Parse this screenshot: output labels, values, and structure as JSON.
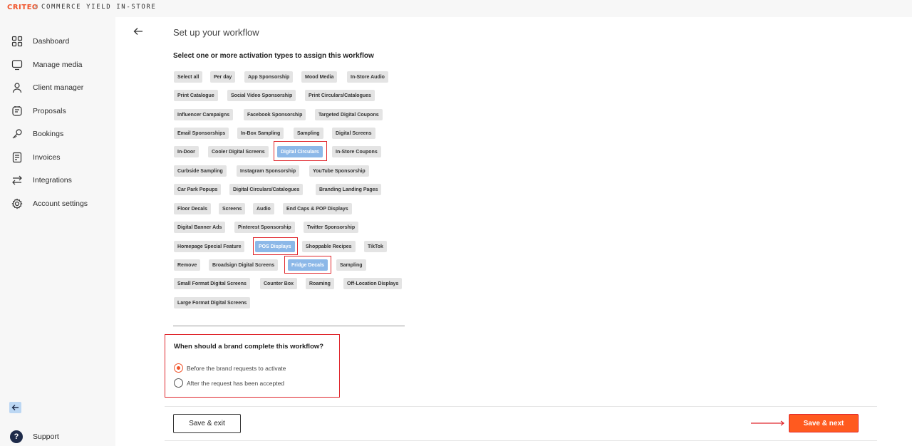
{
  "header": {
    "brand": "CRITEO",
    "separator": "//",
    "product": "COMMERCE YIELD IN-STORE"
  },
  "sidebar": {
    "items": [
      {
        "label": "Dashboard",
        "icon": "dashboard-icon"
      },
      {
        "label": "Manage media",
        "icon": "monitor-icon"
      },
      {
        "label": "Client manager",
        "icon": "user-icon"
      },
      {
        "label": "Proposals",
        "icon": "proposal-icon"
      },
      {
        "label": "Bookings",
        "icon": "key-icon"
      },
      {
        "label": "Invoices",
        "icon": "invoice-icon"
      },
      {
        "label": "Integrations",
        "icon": "arrows-icon"
      },
      {
        "label": "Account settings",
        "icon": "gear-icon"
      }
    ],
    "collapse_icon": "arrow-left-icon",
    "support_label": "Support",
    "support_icon_glyph": "?"
  },
  "page": {
    "title": "Set up your workflow",
    "section_title": "Select one or more activation types to assign this workflow",
    "chips": [
      {
        "label": "Select all",
        "selected": false
      },
      {
        "label": "Per day",
        "selected": false
      },
      {
        "label": "App Sponsorship",
        "selected": false
      },
      {
        "label": "Mood Media",
        "selected": false
      },
      {
        "label": "In-Store Audio",
        "selected": false
      },
      {
        "label": "Print Catalogue",
        "selected": false
      },
      {
        "label": "Social Video Sponsorship",
        "selected": false
      },
      {
        "label": "Print Circulars/Catalogues",
        "selected": false
      },
      {
        "label": "Influencer Campaigns",
        "selected": false
      },
      {
        "label": "Facebook Sponsorship",
        "selected": false
      },
      {
        "label": "Targeted Digital Coupons",
        "selected": false
      },
      {
        "label": "Email Sponsorships",
        "selected": false
      },
      {
        "label": "In-Box Sampling",
        "selected": false
      },
      {
        "label": "Sampling",
        "selected": false
      },
      {
        "label": "Digital Screens",
        "selected": false
      },
      {
        "label": "In-Door",
        "selected": false
      },
      {
        "label": "Cooler Digital Screens",
        "selected": false
      },
      {
        "label": "Digital Circulars",
        "selected": true
      },
      {
        "label": "In-Store Coupons",
        "selected": false
      },
      {
        "label": "Curbside Sampling",
        "selected": false
      },
      {
        "label": "Instagram Sponsorship",
        "selected": false
      },
      {
        "label": "YouTube Sponsorship",
        "selected": false
      },
      {
        "label": "Car Park Popups",
        "selected": false
      },
      {
        "label": "Digital Circulars/Catalogues",
        "selected": false
      },
      {
        "label": "Branding Landing Pages",
        "selected": false
      },
      {
        "label": "Floor Decals",
        "selected": false
      },
      {
        "label": "Screens",
        "selected": false
      },
      {
        "label": "Audio",
        "selected": false
      },
      {
        "label": "End Caps & POP Displays",
        "selected": false
      },
      {
        "label": "Digital Banner Ads",
        "selected": false
      },
      {
        "label": "Pinterest Sponsorship",
        "selected": false
      },
      {
        "label": "Twitter Sponsorship",
        "selected": false
      },
      {
        "label": "Homepage Special Feature",
        "selected": false
      },
      {
        "label": "POS Displays",
        "selected": true
      },
      {
        "label": "Shoppable Recipes",
        "selected": false
      },
      {
        "label": "TikTok",
        "selected": false
      },
      {
        "label": "Remove",
        "selected": false
      },
      {
        "label": "Broadsign Digital Screens",
        "selected": false
      },
      {
        "label": "Fridge Decals",
        "selected": true
      },
      {
        "label": "Sampling",
        "selected": false
      },
      {
        "label": "Small Format Digital Screens",
        "selected": false
      },
      {
        "label": "Counter Box",
        "selected": false
      },
      {
        "label": "Roaming",
        "selected": false
      },
      {
        "label": "Off-Location Displays",
        "selected": false
      },
      {
        "label": "Large Format Digital Screens",
        "selected": false
      }
    ],
    "question": {
      "title": "When should a brand complete this workflow?",
      "options": [
        {
          "label": "Before the brand requests to activate",
          "checked": true
        },
        {
          "label": "After the request has been accepted",
          "checked": false
        }
      ]
    }
  },
  "footer": {
    "save_exit_label": "Save & exit",
    "save_next_label": "Save & next"
  },
  "colors": {
    "brand_orange": "#ff5a1f",
    "chip_selected": "#8cb8e8",
    "annotation_red": "#e0282e"
  }
}
